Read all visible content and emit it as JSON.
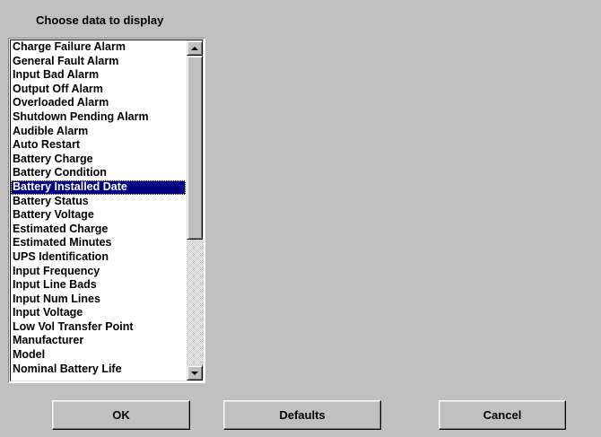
{
  "dialog": {
    "title": "Choose data to display"
  },
  "list": {
    "items": [
      "Charge Failure Alarm",
      "General Fault Alarm",
      "Input Bad Alarm",
      "Output Off Alarm",
      "Overloaded Alarm",
      "Shutdown Pending Alarm",
      "Audible Alarm",
      "Auto Restart",
      "Battery Charge",
      "Battery Condition",
      "Battery Installed Date",
      "Battery Status",
      "Battery Voltage",
      "Estimated Charge",
      "Estimated Minutes",
      "UPS Identification",
      "Input Frequency",
      "Input Line Bads",
      "Input Num Lines",
      "Input Voltage",
      "Low Vol Transfer Point",
      "Manufacturer",
      "Model",
      "Nominal Battery Life"
    ],
    "selected_index": 10,
    "selected_value": "Battery Installed Date",
    "selection_color": "#000080"
  },
  "scrollbar": {
    "up_icon": "arrow-up-icon",
    "down_icon": "arrow-down-icon"
  },
  "buttons": {
    "ok_label": "OK",
    "defaults_label": "Defaults",
    "cancel_label": "Cancel"
  },
  "colors": {
    "background": "#c0c0c0",
    "list_background": "#ffffff"
  }
}
